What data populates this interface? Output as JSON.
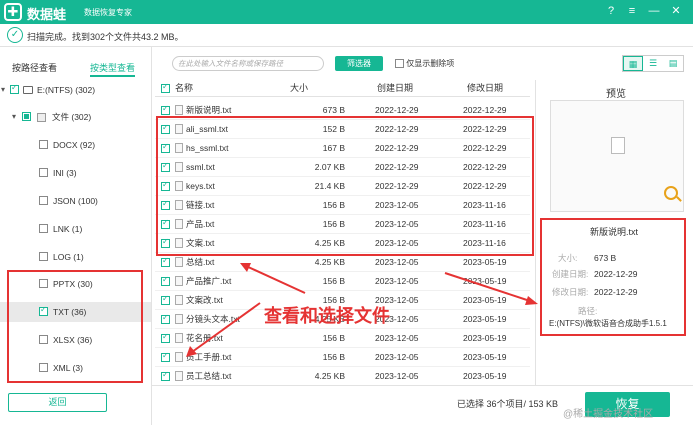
{
  "titlebar": {
    "logo": "✚",
    "app_name": "数据蛙",
    "subtitle": "数据恢复专家",
    "win_buttons": [
      "?",
      "≡",
      "—",
      "✕"
    ]
  },
  "status": {
    "message": "扫描完成。找到302个文件共43.2 MB。"
  },
  "left": {
    "tabs": [
      "按路径查看",
      "按类型查看"
    ],
    "tree": [
      {
        "label": "E:(NTFS) (302)",
        "state": "on"
      },
      {
        "label": "文件 (302)",
        "state": "part"
      },
      {
        "label": "DOCX (92)",
        "state": "off"
      },
      {
        "label": "INI (3)",
        "state": "off"
      },
      {
        "label": "JSON (100)",
        "state": "off"
      },
      {
        "label": "LNK (1)",
        "state": "off"
      },
      {
        "label": "LOG (1)",
        "state": "off"
      },
      {
        "label": "PPTX (30)",
        "state": "off"
      },
      {
        "label": "TXT (36)",
        "state": "on"
      },
      {
        "label": "XLSX (36)",
        "state": "off"
      },
      {
        "label": "XML (3)",
        "state": "off"
      }
    ],
    "back_label": "返回"
  },
  "toolbar": {
    "search_placeholder": "在此处输入文件名称或保存路径",
    "filter_label": "筛选器",
    "only_deleted_label": "仅显示删除项"
  },
  "table": {
    "headers": [
      "名称",
      "大小",
      "创建日期",
      "修改日期"
    ],
    "rows": [
      {
        "name": "新版说明.txt",
        "size": "673  B",
        "created": "2022-12-29",
        "modified": "2022-12-29",
        "checked": true
      },
      {
        "name": "ali_ssml.txt",
        "size": "152  B",
        "created": "2022-12-29",
        "modified": "2022-12-29",
        "checked": true
      },
      {
        "name": "hs_ssml.txt",
        "size": "167  B",
        "created": "2022-12-29",
        "modified": "2022-12-29",
        "checked": true
      },
      {
        "name": "ssml.txt",
        "size": "2.07 KB",
        "created": "2022-12-29",
        "modified": "2022-12-29",
        "checked": true
      },
      {
        "name": "keys.txt",
        "size": "21.4 KB",
        "created": "2022-12-29",
        "modified": "2022-12-29",
        "checked": true
      },
      {
        "name": "链接.txt",
        "size": "156  B",
        "created": "2023-12-05",
        "modified": "2023-11-16",
        "checked": true
      },
      {
        "name": "产品.txt",
        "size": "156  B",
        "created": "2023-12-05",
        "modified": "2023-11-16",
        "checked": true
      },
      {
        "name": "文案.txt",
        "size": "4.25 KB",
        "created": "2023-12-05",
        "modified": "2023-11-16",
        "checked": true
      },
      {
        "name": "总结.txt",
        "size": "4.25 KB",
        "created": "2023-12-05",
        "modified": "2023-05-19",
        "checked": true
      },
      {
        "name": "产品推广.txt",
        "size": "156  B",
        "created": "2023-12-05",
        "modified": "2023-05-19",
        "checked": true
      },
      {
        "name": "文案改.txt",
        "size": "156  B",
        "created": "2023-12-05",
        "modified": "2023-05-19",
        "checked": true
      },
      {
        "name": "分镜头文本.txt",
        "size": "4.25 KB",
        "created": "2023-12-05",
        "modified": "2023-05-19",
        "checked": true
      },
      {
        "name": "花名册.txt",
        "size": "156  B",
        "created": "2023-12-05",
        "modified": "2023-05-19",
        "checked": true
      },
      {
        "name": "员工手册.txt",
        "size": "156  B",
        "created": "2023-12-05",
        "modified": "2023-05-19",
        "checked": true
      },
      {
        "name": "员工总结.txt",
        "size": "4.25 KB",
        "created": "2023-12-05",
        "modified": "2023-05-19",
        "checked": true
      }
    ]
  },
  "preview": {
    "title": "预览",
    "file_name": "新版说明.txt",
    "size_label": "大小:",
    "size": "673  B",
    "created_label": "创建日期:",
    "created": "2022-12-29",
    "modified_label": "修改日期:",
    "modified": "2022-12-29",
    "path_label": "路径:",
    "path": "E:(NTFS)\\微软语音合成助手1.5.1"
  },
  "bottom": {
    "selected": "已选择 36个项目/ 153 KB",
    "recover_label": "恢复"
  },
  "annotation": "查看和选择文件",
  "watermark": "@稀土掘金技术社区",
  "colors": {
    "accent": "#16b794",
    "highlight": "#e53333"
  }
}
